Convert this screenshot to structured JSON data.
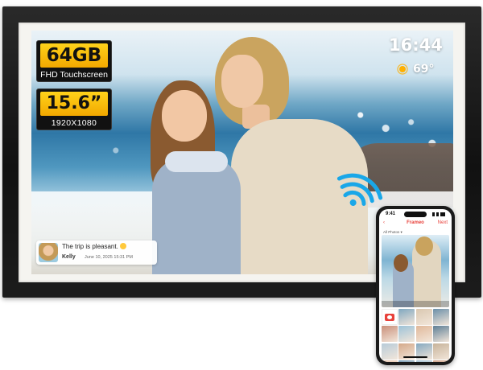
{
  "product_badges": {
    "storage": {
      "value": "64GB",
      "subtitle": "FHD Touchscreen"
    },
    "screen": {
      "value": "15.6”",
      "subtitle": "1920X1080"
    }
  },
  "screen_overlay": {
    "clock": "16:44",
    "weather": {
      "icon": "sun-icon",
      "temperature": "69°"
    },
    "wifi_icon": "wifi-icon"
  },
  "message_card": {
    "text": "The trip is pleasant.",
    "sender": "Kelly",
    "timestamp": "June 10, 2025  15:31 PM"
  },
  "phone_app": {
    "status_time": "9:41",
    "back_label": "‹",
    "title": "Frameo",
    "next_label": "Next",
    "filter_label": "All Photos ▾"
  },
  "colors": {
    "accent_red": "#e8403a",
    "badge_yellow": "#ffd21a",
    "wifi_blue": "#1aa7e8",
    "frame_black": "#141414"
  },
  "phone_grid_cells": [
    "#ffffff",
    "#7fa7bf",
    "#d9c7b0",
    "#6b8fa8",
    "#c98f7a",
    "#9cc2d8",
    "#e0b89a",
    "#5d7e96",
    "#b7cbd9",
    "#d4a98a",
    "#86a9c0",
    "#c7b39a",
    "#e6c7b2",
    "#7a9db6",
    "#a8c3d4",
    "#cfa58d"
  ]
}
